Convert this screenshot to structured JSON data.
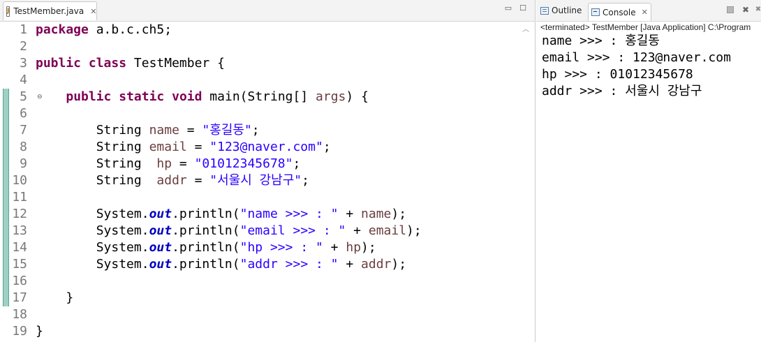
{
  "editor": {
    "tab_label": "TestMember.java",
    "tab_icon": "java-file-icon",
    "lines": [
      {
        "n": "1",
        "tokens": [
          {
            "t": "package",
            "c": "kw"
          },
          {
            "t": " a.b.c.ch5;",
            "c": ""
          }
        ]
      },
      {
        "n": "2",
        "tokens": []
      },
      {
        "n": "3",
        "tokens": [
          {
            "t": "public",
            "c": "kw"
          },
          {
            "t": " ",
            "c": ""
          },
          {
            "t": "class",
            "c": "kw"
          },
          {
            "t": " TestMember {",
            "c": ""
          }
        ]
      },
      {
        "n": "4",
        "tokens": []
      },
      {
        "n": "5",
        "tokens": [
          {
            "t": "    ",
            "c": ""
          },
          {
            "t": "public",
            "c": "kw"
          },
          {
            "t": " ",
            "c": ""
          },
          {
            "t": "static",
            "c": "kw"
          },
          {
            "t": " ",
            "c": ""
          },
          {
            "t": "void",
            "c": "kw"
          },
          {
            "t": " main(String[] ",
            "c": ""
          },
          {
            "t": "args",
            "c": "var"
          },
          {
            "t": ") {",
            "c": ""
          }
        ]
      },
      {
        "n": "6",
        "tokens": []
      },
      {
        "n": "7",
        "tokens": [
          {
            "t": "        String ",
            "c": ""
          },
          {
            "t": "name",
            "c": "var"
          },
          {
            "t": " = ",
            "c": ""
          },
          {
            "t": "\"홍길동\"",
            "c": "str"
          },
          {
            "t": ";",
            "c": ""
          }
        ]
      },
      {
        "n": "8",
        "tokens": [
          {
            "t": "        String ",
            "c": ""
          },
          {
            "t": "email",
            "c": "var"
          },
          {
            "t": " = ",
            "c": ""
          },
          {
            "t": "\"123@naver.com\"",
            "c": "str"
          },
          {
            "t": ";",
            "c": ""
          }
        ]
      },
      {
        "n": "9",
        "tokens": [
          {
            "t": "        String  ",
            "c": ""
          },
          {
            "t": "hp",
            "c": "var"
          },
          {
            "t": " = ",
            "c": ""
          },
          {
            "t": "\"01012345678\"",
            "c": "str"
          },
          {
            "t": ";",
            "c": ""
          }
        ]
      },
      {
        "n": "10",
        "tokens": [
          {
            "t": "        String  ",
            "c": ""
          },
          {
            "t": "addr",
            "c": "var"
          },
          {
            "t": " = ",
            "c": ""
          },
          {
            "t": "\"서울시 강남구\"",
            "c": "str"
          },
          {
            "t": ";",
            "c": ""
          }
        ]
      },
      {
        "n": "11",
        "tokens": []
      },
      {
        "n": "12",
        "tokens": [
          {
            "t": "        System.",
            "c": ""
          },
          {
            "t": "out",
            "c": "fld"
          },
          {
            "t": ".println(",
            "c": ""
          },
          {
            "t": "\"name >>> : \"",
            "c": "str"
          },
          {
            "t": " + ",
            "c": ""
          },
          {
            "t": "name",
            "c": "var"
          },
          {
            "t": ");",
            "c": ""
          }
        ]
      },
      {
        "n": "13",
        "tokens": [
          {
            "t": "        System.",
            "c": ""
          },
          {
            "t": "out",
            "c": "fld"
          },
          {
            "t": ".println(",
            "c": ""
          },
          {
            "t": "\"email >>> : \"",
            "c": "str"
          },
          {
            "t": " + ",
            "c": ""
          },
          {
            "t": "email",
            "c": "var"
          },
          {
            "t": ");",
            "c": ""
          }
        ]
      },
      {
        "n": "14",
        "tokens": [
          {
            "t": "        System.",
            "c": ""
          },
          {
            "t": "out",
            "c": "fld"
          },
          {
            "t": ".println(",
            "c": ""
          },
          {
            "t": "\"hp >>> : \"",
            "c": "str"
          },
          {
            "t": " + ",
            "c": ""
          },
          {
            "t": "hp",
            "c": "var"
          },
          {
            "t": ");",
            "c": ""
          }
        ]
      },
      {
        "n": "15",
        "tokens": [
          {
            "t": "        System.",
            "c": ""
          },
          {
            "t": "out",
            "c": "fld"
          },
          {
            "t": ".println(",
            "c": ""
          },
          {
            "t": "\"addr >>> : \"",
            "c": "str"
          },
          {
            "t": " + ",
            "c": ""
          },
          {
            "t": "addr",
            "c": "var"
          },
          {
            "t": ");",
            "c": ""
          }
        ]
      },
      {
        "n": "16",
        "tokens": []
      },
      {
        "n": "17",
        "tokens": [
          {
            "t": "    }",
            "c": ""
          }
        ]
      },
      {
        "n": "18",
        "tokens": []
      },
      {
        "n": "19",
        "tokens": [
          {
            "t": "}",
            "c": ""
          }
        ]
      }
    ],
    "fold_line": "5"
  },
  "views": {
    "outline_label": "Outline",
    "console_label": "Console",
    "status": "<terminated> TestMember [Java Application] C:\\Program",
    "output": [
      "name >>> : 홍길동",
      "email >>> : 123@naver.com",
      "hp >>> : 01012345678",
      "addr >>> : 서울시 강남구"
    ]
  },
  "icons": {
    "close": "close-icon",
    "minimize": "minimize-icon",
    "maximize": "maximize-icon"
  },
  "colors": {
    "keyword": "#7f0055",
    "string": "#2a00ff",
    "variable": "#6a3e3e",
    "field": "#0000c0",
    "change_bar": "#9ed1c3"
  }
}
